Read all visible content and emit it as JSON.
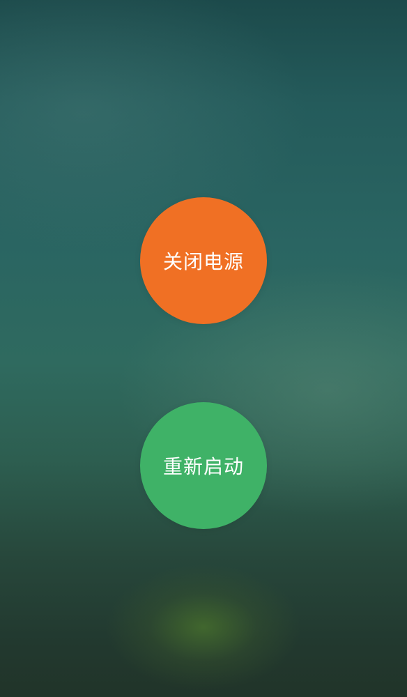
{
  "power_menu": {
    "power_off": {
      "label": "关闭电源",
      "color": "#f07024"
    },
    "reboot": {
      "label": "重新启动",
      "color": "#3fb267"
    }
  }
}
